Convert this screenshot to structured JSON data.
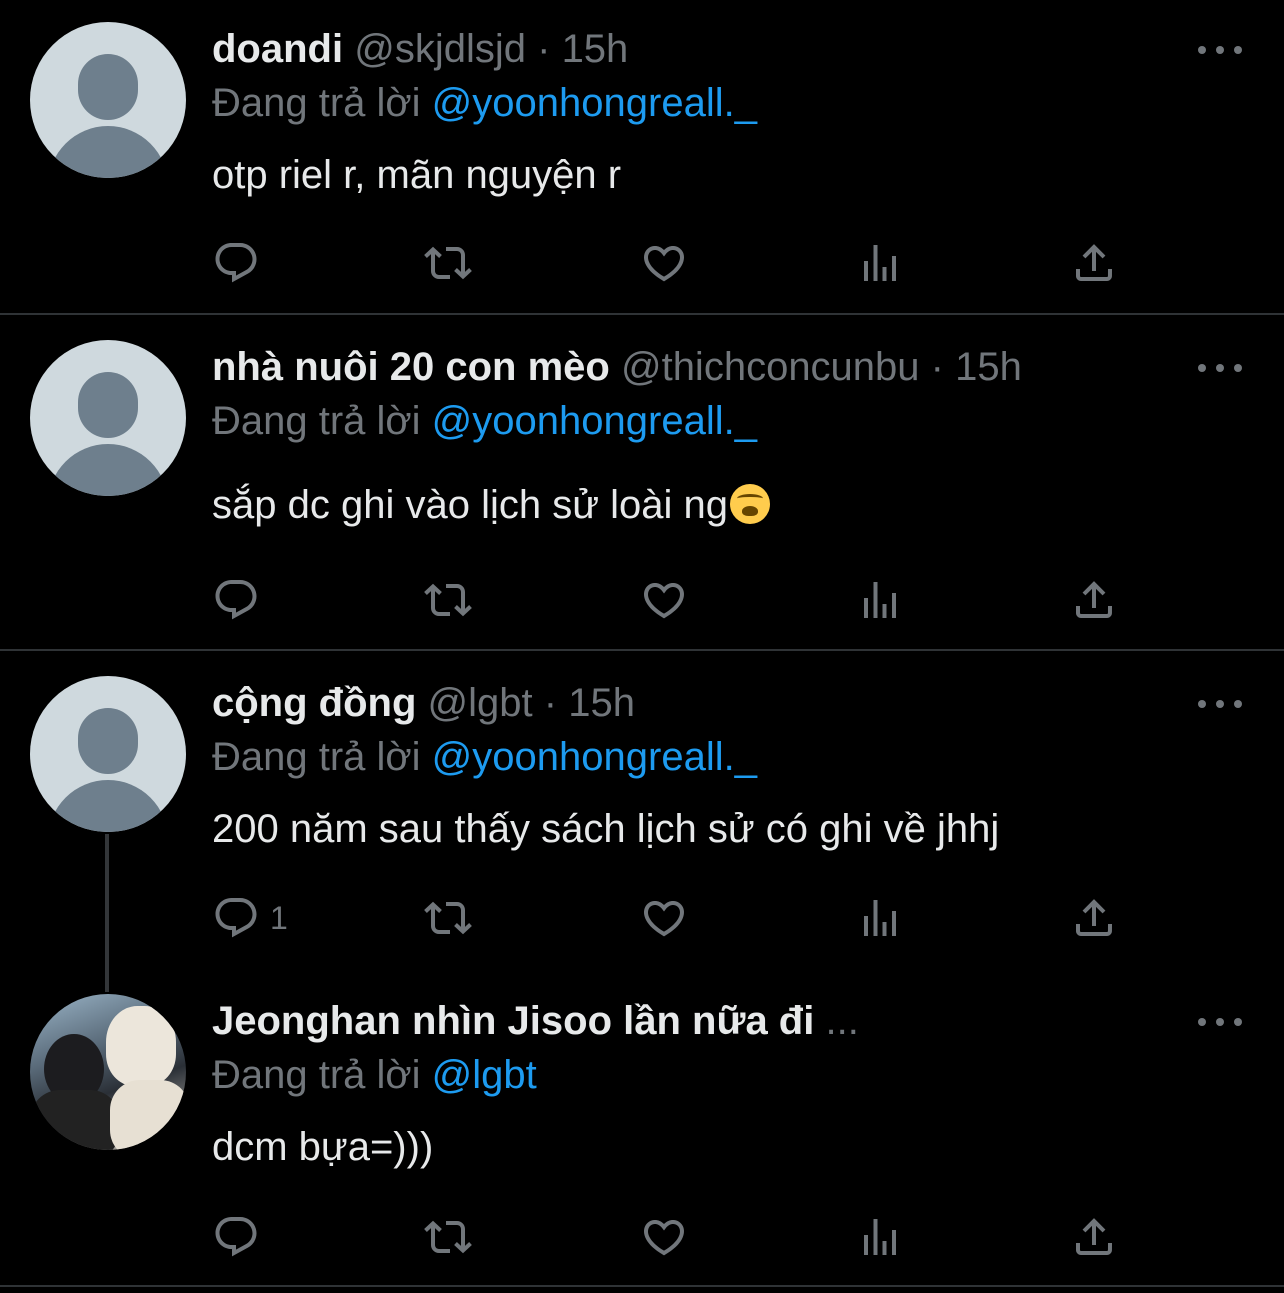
{
  "tweets": [
    {
      "name": "doandi",
      "handle": "@skjdlsjd",
      "separator": "·",
      "time": "15h",
      "reply_prefix": "Đang trả lời",
      "reply_to": "@yoonhongreall._",
      "text": "otp riel r, mãn nguyện r",
      "reply_count": ""
    },
    {
      "name": "nhà nuôi 20 con mèo",
      "handle": "@thichconcunbu",
      "separator": "·",
      "time": "15h",
      "reply_prefix": "Đang trả lời",
      "reply_to": "@yoonhongreall._",
      "text": "sắp dc ghi vào lịch sử loài ng",
      "emoji": "crying-face-emoji",
      "reply_count": ""
    },
    {
      "name": "cộng đồng",
      "handle": "@lgbt",
      "separator": "·",
      "time": "15h",
      "reply_prefix": "Đang trả lời",
      "reply_to": "@yoonhongreall._",
      "text": "200 năm sau thấy sách lịch sử có ghi về jhhj",
      "reply_count": "1"
    },
    {
      "name": "Jeonghan nhìn Jisoo lần nữa đi",
      "name_ellipsis": "...",
      "reply_prefix": "Đang trả lời",
      "reply_to": "@lgbt",
      "text": "dcm bựa=)))",
      "reply_count": ""
    }
  ],
  "icons": {
    "reply": "reply-icon",
    "retweet": "retweet-icon",
    "like": "heart-icon",
    "views": "views-icon",
    "share": "share-icon",
    "more": "more-icon"
  },
  "colors": {
    "background": "#000000",
    "text": "#e7e9ea",
    "muted": "#71767b",
    "mention": "#1d9bf0",
    "divider": "#2f3336"
  }
}
